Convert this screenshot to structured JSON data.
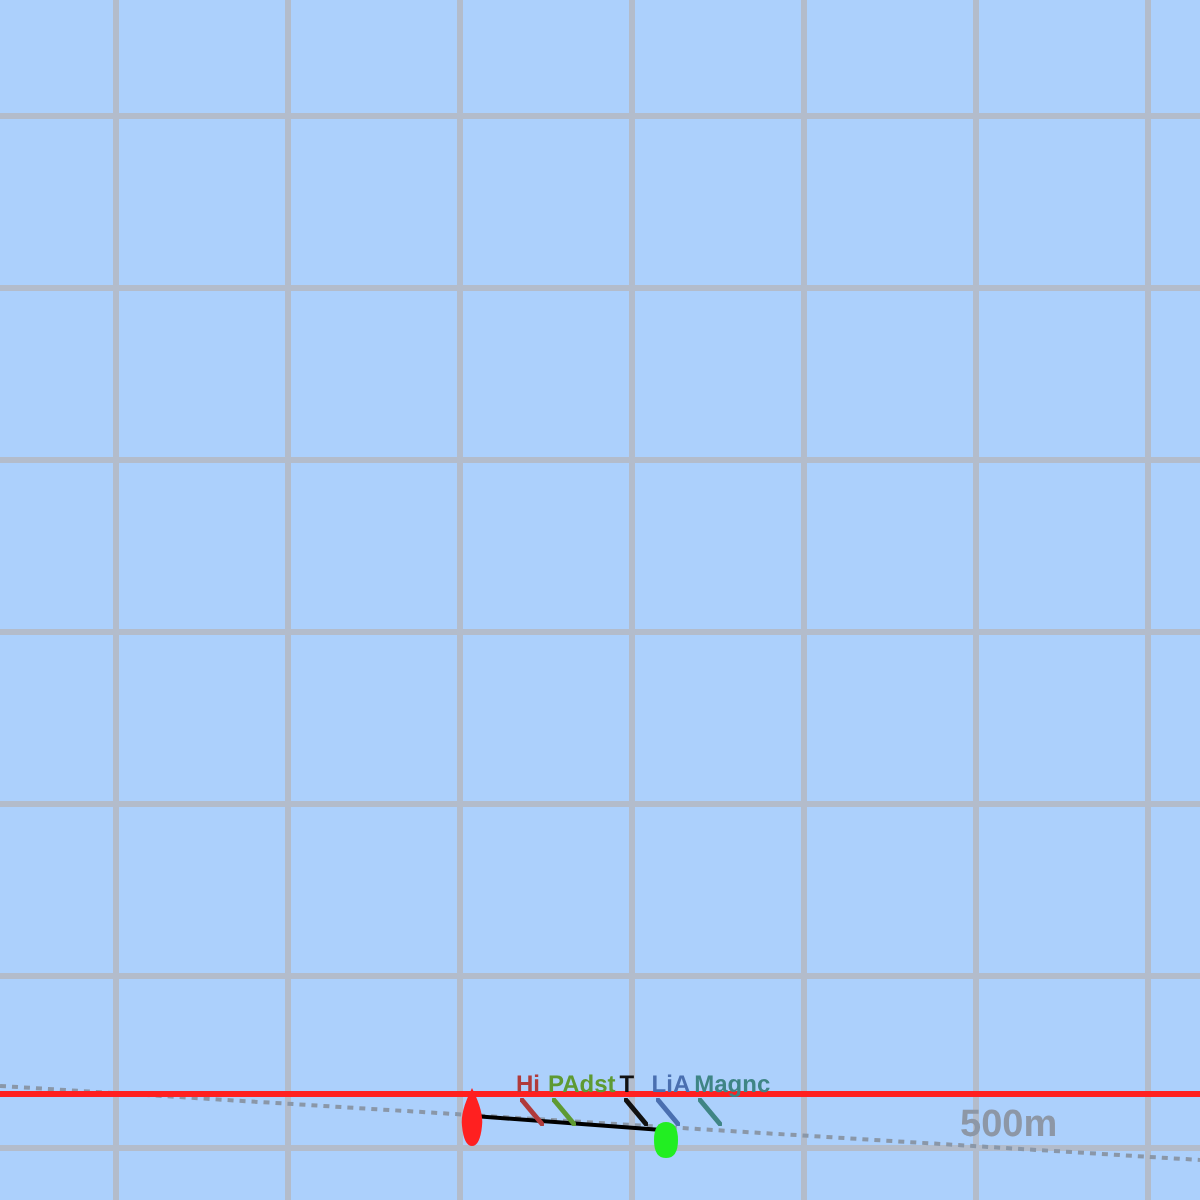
{
  "map": {
    "scale_label": "500m"
  },
  "marks": [
    {
      "kind": "pin",
      "color": "#ff2020"
    },
    {
      "kind": "buoy",
      "color": "#22ee22"
    }
  ],
  "boats": [
    {
      "name": "Hi",
      "color": "#b03a3a"
    },
    {
      "name": "PAdst",
      "color": "#5e9a32"
    },
    {
      "name": "T",
      "color": "#111111"
    },
    {
      "name": "LiA",
      "color": "#4a6fb0"
    },
    {
      "name": "Magnc",
      "color": "#3f8585"
    }
  ]
}
